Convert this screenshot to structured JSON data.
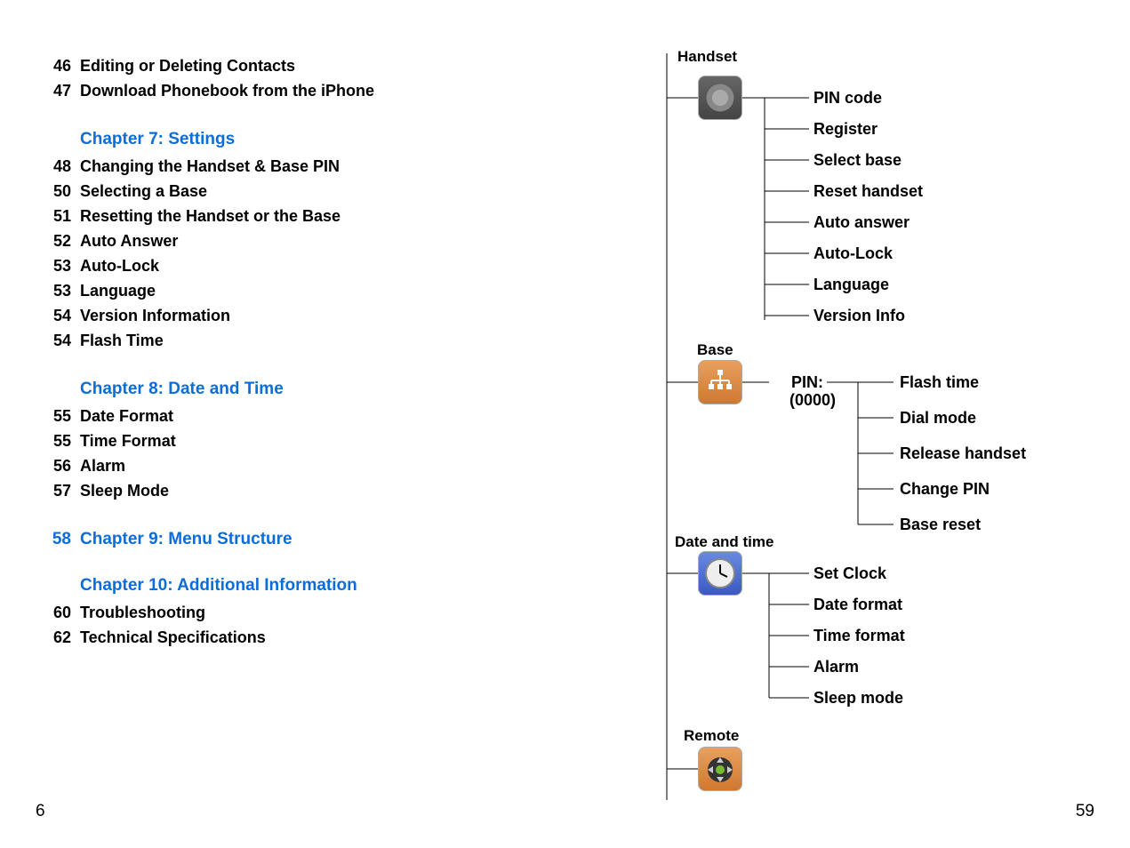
{
  "leftPageNumber": "6",
  "rightPageNumber": "59",
  "toc": {
    "preItems": [
      {
        "page": "46",
        "title": "Editing or Deleting Contacts"
      },
      {
        "page": "47",
        "title": "Download Phonebook from the iPhone"
      }
    ],
    "chapter7": {
      "heading": "Chapter 7:  Settings",
      "items": [
        {
          "page": "48",
          "title": "Changing the Handset & Base PIN"
        },
        {
          "page": "50",
          "title": "Selecting a Base"
        },
        {
          "page": "51",
          "title": "Resetting the Handset or the Base"
        },
        {
          "page": "52",
          "title": "Auto Answer"
        },
        {
          "page": "53",
          "title": "Auto-Lock"
        },
        {
          "page": "53",
          "title": "Language"
        },
        {
          "page": "54",
          "title": "Version Information"
        },
        {
          "page": "54",
          "title": "Flash Time"
        }
      ]
    },
    "chapter8": {
      "heading": "Chapter 8:  Date and Time",
      "items": [
        {
          "page": "55",
          "title": "Date Format"
        },
        {
          "page": "55",
          "title": "Time Format"
        },
        {
          "page": "56",
          "title": "Alarm"
        },
        {
          "page": "57",
          "title": "Sleep Mode"
        }
      ]
    },
    "chapter9": {
      "page": "58",
      "heading": "Chapter 9:  Menu Structure"
    },
    "chapter10": {
      "heading": "Chapter 10:  Additional Information",
      "items": [
        {
          "page": "60",
          "title": "Troubleshooting"
        },
        {
          "page": "62",
          "title": "Technical Specifications"
        }
      ]
    }
  },
  "menu": {
    "handset": {
      "label": "Handset",
      "items": [
        "PIN code",
        "Register",
        "Select base",
        "Reset handset",
        "Auto answer",
        "Auto-Lock",
        "Language",
        "Version Info"
      ]
    },
    "base": {
      "label": "Base",
      "pinLabel": "PIN:",
      "pinValue": "(0000)",
      "items": [
        "Flash time",
        "Dial mode",
        "Release handset",
        "Change PIN",
        "Base reset"
      ]
    },
    "datetime": {
      "label": "Date and time",
      "items": [
        "Set Clock",
        "Date format",
        "Time format",
        "Alarm",
        "Sleep mode"
      ]
    },
    "remote": {
      "label": "Remote"
    }
  }
}
